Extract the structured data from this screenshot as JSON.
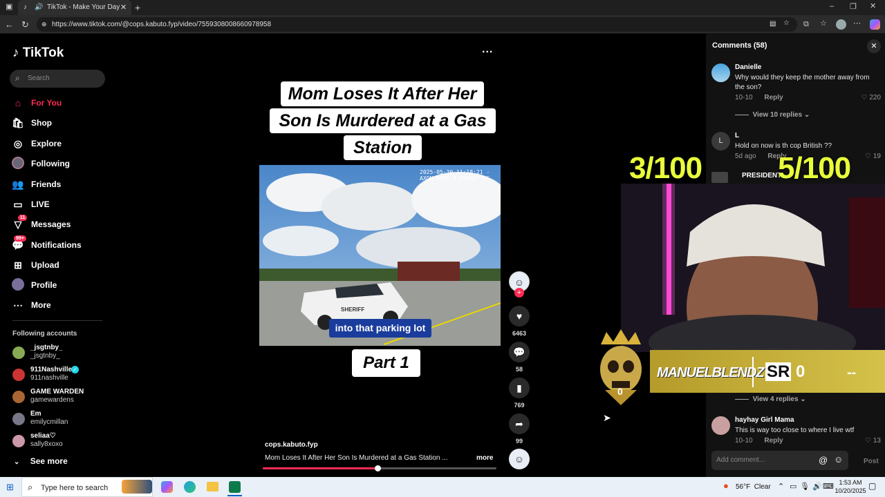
{
  "browser": {
    "tab_title": "TikTok - Make Your Day",
    "url": "https://www.tiktok.com/@cops.kabuto.fyp/video/7559308008660978958"
  },
  "sidebar": {
    "logo": "TikTok",
    "search_placeholder": "Search",
    "nav": [
      {
        "label": "For You",
        "icon": "home-icon"
      },
      {
        "label": "Shop",
        "icon": "shop-icon"
      },
      {
        "label": "Explore",
        "icon": "compass-icon"
      },
      {
        "label": "Following",
        "icon": "following-icon"
      },
      {
        "label": "Friends",
        "icon": "friends-icon"
      },
      {
        "label": "LIVE",
        "icon": "live-icon"
      },
      {
        "label": "Messages",
        "icon": "messages-icon",
        "badge": "11"
      },
      {
        "label": "Notifications",
        "icon": "bell-icon",
        "badge": "99+"
      },
      {
        "label": "Upload",
        "icon": "upload-icon"
      },
      {
        "label": "Profile",
        "icon": "profile-icon"
      },
      {
        "label": "More",
        "icon": "more-icon"
      }
    ],
    "following_header": "Following accounts",
    "accounts": [
      {
        "name": "_jsgtnby_",
        "handle": "_jsgtnby_"
      },
      {
        "name": "911Nashville",
        "handle": "911nashville"
      },
      {
        "name": "GAME WARDEN",
        "handle": "gamewardens"
      },
      {
        "name": "Em",
        "handle": "emilycmillan"
      },
      {
        "name": "seliaa♡",
        "handle": "sally8xoxo"
      }
    ],
    "see_more": "See more"
  },
  "video": {
    "title_lines": [
      "Mom Loses It After Her",
      "Son Is Murdered at a Gas",
      "Station"
    ],
    "cam_stamp": "2025-05-30 11:18:21 -\nAXON BODY 4 D34A87766",
    "caption": "into that parking lot",
    "part": "Part 1",
    "author": "cops.kabuto.fyp",
    "description": "Mom Loses It After Her Son Is Murdered at a Gas Station ...",
    "more": "more",
    "progress": 0.49,
    "menu": "..."
  },
  "actions": {
    "likes": "6463",
    "comments": "58",
    "saves": "769",
    "shares": "99"
  },
  "comments": {
    "header": "Comments (58)",
    "items": [
      {
        "name": "Danielle",
        "text": "Why would they keep the mother away from the son?",
        "date": "10-10",
        "reply": "Reply",
        "likes": "220",
        "view_replies": "View 10 replies"
      },
      {
        "name": "L",
        "text": "Hold on now is th cop British ??",
        "date": "5d ago",
        "reply": "Reply",
        "likes": "19"
      },
      {
        "name": "PRESIDENT",
        "text": "",
        "date": "",
        "reply": "",
        "likes": ""
      },
      {
        "name": "hayhay Girl Mama",
        "text": "This is way too close to where I live wtf",
        "date": "10-10",
        "reply": "Reply",
        "likes": "13"
      }
    ],
    "view_replies_lower": "View 4 replies",
    "add_placeholder": "Add comment...",
    "post": "Post"
  },
  "overlay": {
    "score_left": "3/100",
    "score_right": "5/100",
    "streamer": "MANUELBLENDZ",
    "sr": "SR",
    "sr_value": "0",
    "dashes": "--",
    "crown_value": "0"
  },
  "taskbar": {
    "search_placeholder": "Type here to search",
    "weather": "56°F  Clear",
    "time": "1:53 AM",
    "date": "10/20/2025"
  },
  "colors": {
    "accent": "#fe2c55",
    "overlay_yellow": "#e8ff3a",
    "banner_gold": "#c9b43a"
  }
}
